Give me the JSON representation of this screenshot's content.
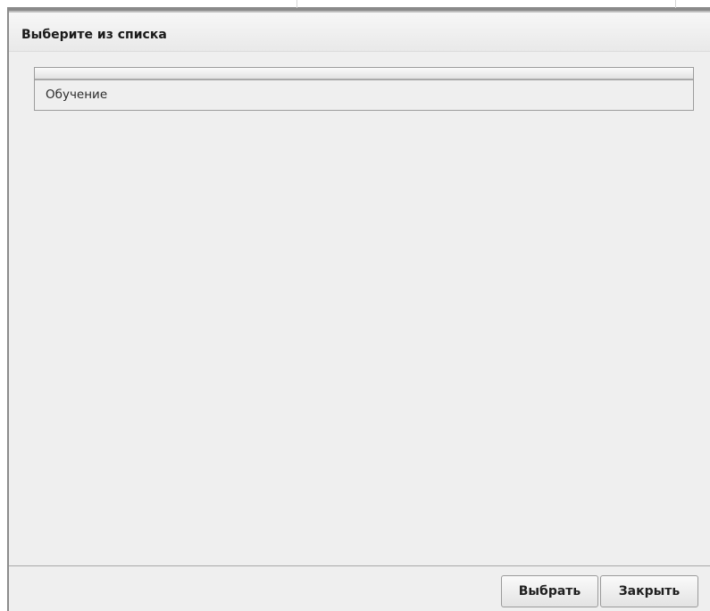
{
  "dialog": {
    "title": "Выберите из списка",
    "list": {
      "items": [
        {
          "label": "Обучение"
        }
      ]
    },
    "buttons": {
      "select_label": "Выбрать",
      "close_label": "Закрыть"
    }
  }
}
